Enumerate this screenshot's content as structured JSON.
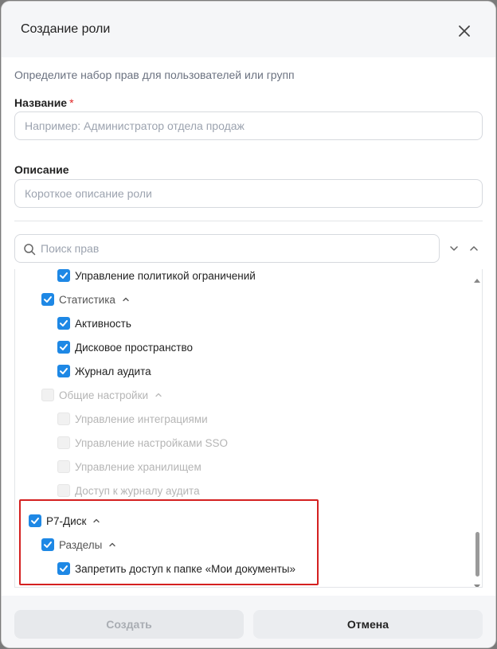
{
  "dialog": {
    "title": "Создание роли",
    "subtitle": "Определите набор прав для пользователей или групп"
  },
  "form": {
    "name_label": "Название",
    "name_required_mark": "*",
    "name_placeholder": "Например: Администратор отдела продаж",
    "description_label": "Описание",
    "description_placeholder": "Короткое описание роли"
  },
  "search": {
    "placeholder": "Поиск прав"
  },
  "tree": {
    "rows": [
      {
        "label": "Управление политикой ограничений",
        "checked": true,
        "disabled": false,
        "expandable": false
      },
      {
        "label": "Статистика",
        "checked": true,
        "disabled": false,
        "expandable": true
      },
      {
        "label": "Активность",
        "checked": true,
        "disabled": false,
        "expandable": false
      },
      {
        "label": "Дисковое пространство",
        "checked": true,
        "disabled": false,
        "expandable": false
      },
      {
        "label": "Журнал аудита",
        "checked": true,
        "disabled": false,
        "expandable": false
      },
      {
        "label": "Общие настройки",
        "checked": false,
        "disabled": true,
        "expandable": true
      },
      {
        "label": "Управление интеграциями",
        "checked": false,
        "disabled": true,
        "expandable": false
      },
      {
        "label": "Управление настройками SSO",
        "checked": false,
        "disabled": true,
        "expandable": false
      },
      {
        "label": "Управление хранилищем",
        "checked": false,
        "disabled": true,
        "expandable": false
      },
      {
        "label": "Доступ к журналу аудита",
        "checked": false,
        "disabled": true,
        "expandable": false
      },
      {
        "label": "Р7-Диск",
        "checked": true,
        "disabled": false,
        "expandable": true
      },
      {
        "label": "Разделы",
        "checked": true,
        "disabled": false,
        "expandable": true
      },
      {
        "label": "Запретить доступ к папке «Мои документы»",
        "checked": true,
        "disabled": false,
        "expandable": false
      }
    ]
  },
  "footer": {
    "create_label": "Создать",
    "cancel_label": "Отмена"
  },
  "colors": {
    "accent": "#1e88e5",
    "highlight": "#d42020"
  }
}
